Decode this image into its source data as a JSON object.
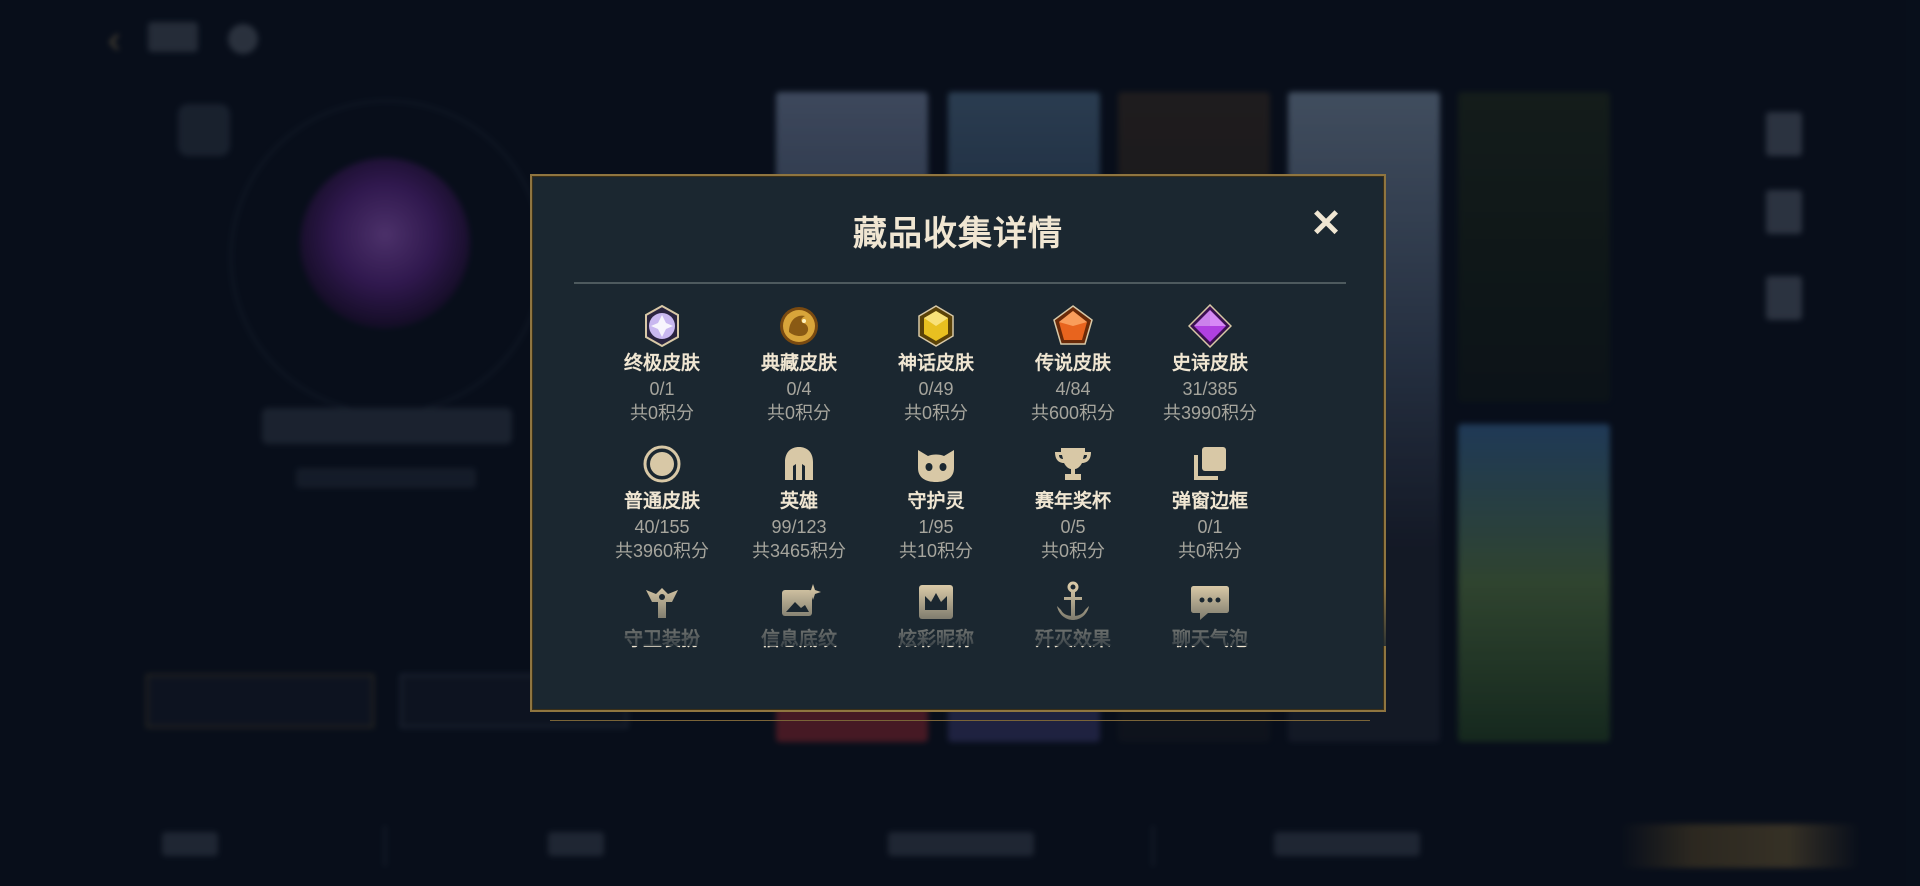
{
  "modal": {
    "title": "藏品收集详情",
    "close_label": "✕"
  },
  "categories": [
    {
      "label": "终极皮肤",
      "count": "0/1",
      "points": "共0积分",
      "icon": "ultimate-gem-icon",
      "color": "#c9b8f0"
    },
    {
      "label": "典藏皮肤",
      "count": "0/4",
      "points": "共0积分",
      "icon": "dragon-emblem-icon",
      "color": "#d9a53a"
    },
    {
      "label": "神话皮肤",
      "count": "0/49",
      "points": "共0积分",
      "icon": "mythic-gem-icon",
      "color": "#e8c020"
    },
    {
      "label": "传说皮肤",
      "count": "4/84",
      "points": "共600积分",
      "icon": "legendary-gem-icon",
      "color": "#e8641e"
    },
    {
      "label": "史诗皮肤",
      "count": "31/385",
      "points": "共3990积分",
      "icon": "epic-gem-icon",
      "color": "#b040e0"
    },
    {
      "label": "普通皮肤",
      "count": "40/155",
      "points": "共3960积分",
      "icon": "circle-icon",
      "color": "#d8c8a6"
    },
    {
      "label": "英雄",
      "count": "99/123",
      "points": "共3465积分",
      "icon": "helmet-icon",
      "color": "#d8c8a6"
    },
    {
      "label": "守护灵",
      "count": "1/95",
      "points": "共10积分",
      "icon": "pet-face-icon",
      "color": "#d8c8a6"
    },
    {
      "label": "赛年奖杯",
      "count": "0/5",
      "points": "共0积分",
      "icon": "trophy-icon",
      "color": "#d8c8a6"
    },
    {
      "label": "弹窗边框",
      "count": "0/1",
      "points": "共0积分",
      "icon": "frame-stack-icon",
      "color": "#d8c8a6"
    },
    {
      "label": "守卫装扮",
      "icon": "ward-icon",
      "color": "#d8c8a6"
    },
    {
      "label": "信息底纹",
      "icon": "image-sparkle-icon",
      "color": "#d8c8a6"
    },
    {
      "label": "炫彩昵称",
      "icon": "crown-card-icon",
      "color": "#d8c8a6"
    },
    {
      "label": "歼灭效果",
      "icon": "anchor-sword-icon",
      "color": "#d8c8a6"
    },
    {
      "label": "聊天气泡",
      "icon": "chat-bubble-icon",
      "color": "#d8c8a6"
    }
  ],
  "colors": {
    "gold_border": "#8f7540",
    "modal_bg": "#1b2730",
    "title_text": "#f0e6d2",
    "muted_text": "#a6a59d"
  }
}
